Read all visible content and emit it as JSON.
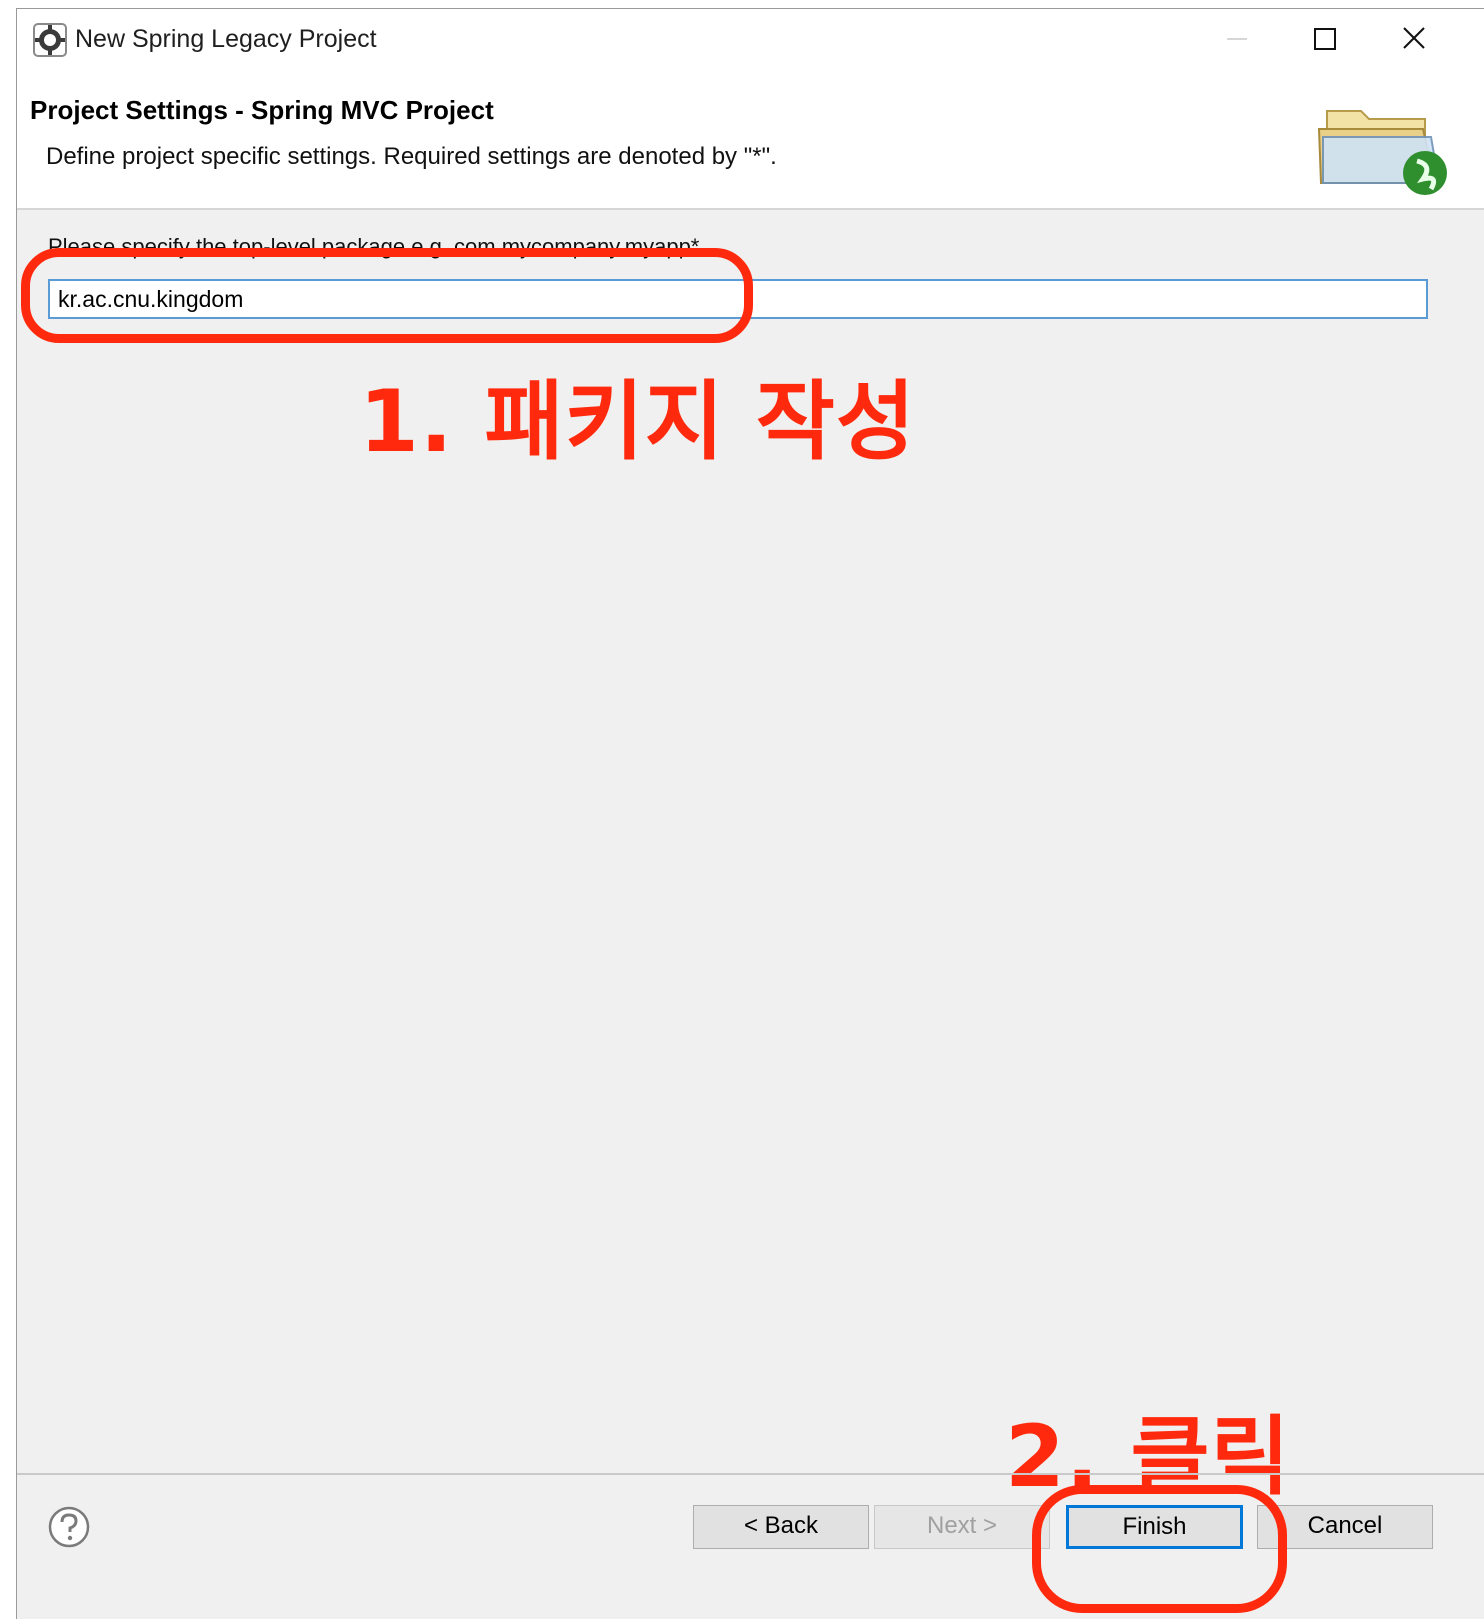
{
  "window": {
    "title": "New Spring Legacy Project"
  },
  "header": {
    "title": "Project Settings - Spring MVC Project",
    "description": "Define project specific settings. Required settings are denoted by \"*\"."
  },
  "form": {
    "package_label": "Please specify the top-level package e.g. com.mycompany.myapp*",
    "package_value": "kr.ac.cnu.kingdom"
  },
  "annotations": {
    "step1": "1. 패키지 작성",
    "step2": "2. 클릭",
    "color": "#ff2a0d"
  },
  "buttons": {
    "back": "< Back",
    "next": "Next >",
    "finish": "Finish",
    "cancel": "Cancel"
  },
  "icons": {
    "app": "spring-gear-icon",
    "banner": "folder-spring-icon",
    "help": "help-icon"
  }
}
